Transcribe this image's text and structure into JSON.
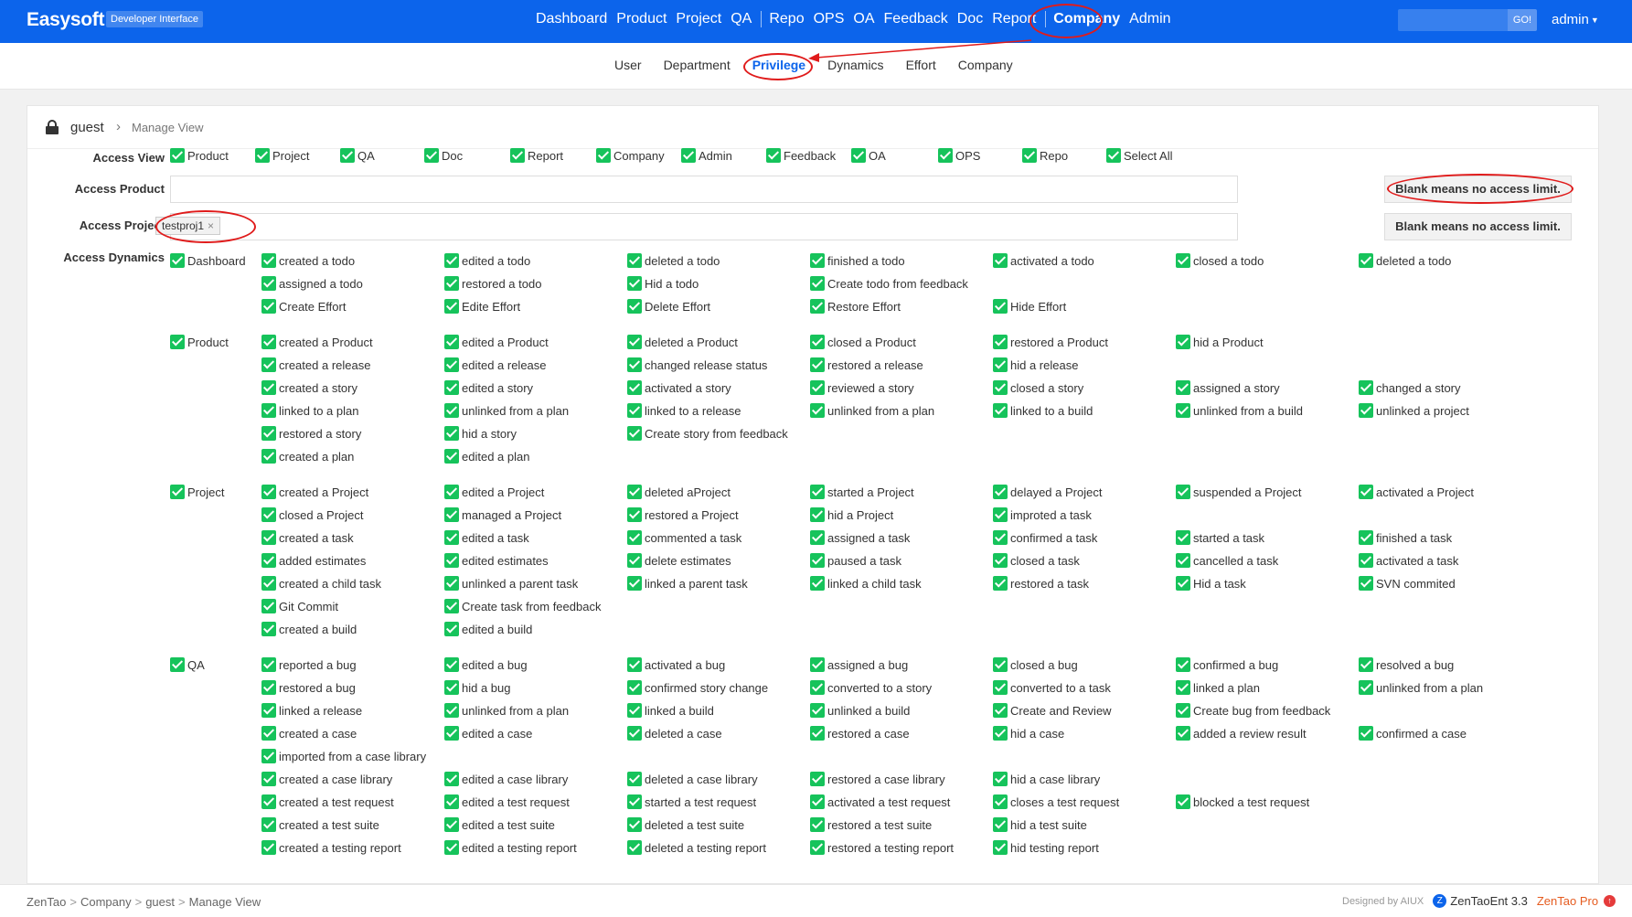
{
  "brand": {
    "name": "Easysoft",
    "badge": "Developer Interface"
  },
  "nav": {
    "items": [
      "Dashboard",
      "Product",
      "Project",
      "QA",
      "Repo",
      "OPS",
      "OA",
      "Feedback",
      "Doc",
      "Report",
      "Company",
      "Admin"
    ],
    "active": "Company"
  },
  "search": {
    "placeholder": "",
    "go_label": "GO!"
  },
  "user": {
    "name": "admin"
  },
  "subnav": {
    "items": [
      "User",
      "Department",
      "Privilege",
      "Dynamics",
      "Effort",
      "Company"
    ],
    "active": "Privilege"
  },
  "breadcrumb": {
    "user": "guest",
    "view": "Manage View"
  },
  "access_view": {
    "label": "Access View",
    "items": [
      "Product",
      "Project",
      "QA",
      "Doc",
      "Report",
      "Company",
      "Admin",
      "Feedback",
      "OA",
      "OPS",
      "Repo",
      "Select All"
    ]
  },
  "access_product": {
    "label": "Access Product",
    "value": "",
    "hint": "Blank means no access limit."
  },
  "access_project": {
    "label": "Access Project",
    "tag": "testproj1",
    "tag_remove": "×",
    "hint": "Blank means no access limit."
  },
  "access_dynamics": {
    "label": "Access Dynamics",
    "groups": [
      {
        "name": "Dashboard",
        "rows": [
          [
            "created a todo",
            "edited a todo",
            "deleted a todo",
            "finished a todo",
            "activated a todo",
            "closed a todo",
            "deleted a todo"
          ],
          [
            "assigned a todo",
            "restored a todo",
            "Hid a todo",
            "Create todo from feedback",
            "",
            "",
            ""
          ],
          [
            "Create Effort",
            "Edite Effort",
            "Delete Effort",
            "Restore Effort",
            "Hide Effort",
            "",
            ""
          ]
        ]
      },
      {
        "name": "Product",
        "rows": [
          [
            "created a Product",
            "edited a Product",
            "deleted a Product",
            "closed a Product",
            "restored a Product",
            "hid a Product",
            ""
          ],
          [
            "created a release",
            "edited a release",
            "changed release status",
            "restored a release",
            "hid a release",
            "",
            ""
          ],
          [
            "created a story",
            "edited a story",
            "activated a story",
            "reviewed a story",
            "closed a story",
            "assigned a story",
            "changed a story"
          ],
          [
            "linked to a plan",
            "unlinked from a plan",
            "linked to a release",
            "unlinked from a plan",
            "linked to a build",
            "unlinked from a build",
            "unlinked a project"
          ],
          [
            "restored a story",
            "hid a story",
            "Create story from feedback",
            "",
            "",
            "",
            ""
          ],
          [
            "created a plan",
            "edited a plan",
            "",
            "",
            "",
            "",
            ""
          ]
        ]
      },
      {
        "name": "Project",
        "rows": [
          [
            "created a Project",
            "edited a Project",
            "deleted aProject",
            "started a Project",
            "delayed a Project",
            "suspended a Project",
            "activated a Project"
          ],
          [
            "closed a Project",
            "managed a Project",
            "restored a Project",
            "hid a Project",
            "improted a task",
            "",
            ""
          ],
          [
            "created a task",
            "edited a task",
            "commented a task",
            "assigned a task",
            "confirmed a task",
            "started a task",
            "finished a task"
          ],
          [
            "added estimates",
            "edited estimates",
            "delete estimates",
            "paused a task",
            "closed a task",
            "cancelled a task",
            "activated a task"
          ],
          [
            "created a child task",
            "unlinked a parent task",
            "linked a parent task",
            "linked a child task",
            "restored a task",
            "Hid a task",
            "SVN commited"
          ],
          [
            "Git Commit",
            "Create task from feedback",
            "",
            "",
            "",
            "",
            ""
          ],
          [
            "created a build",
            "edited a build",
            "",
            "",
            "",
            "",
            ""
          ]
        ]
      },
      {
        "name": "QA",
        "rows": [
          [
            "reported a bug",
            "edited a bug",
            "activated a bug",
            "assigned a bug",
            "closed a bug",
            "confirmed a bug",
            "resolved a bug"
          ],
          [
            "restored a bug",
            "hid a bug",
            "confirmed story change",
            "converted to a story",
            "converted to a task",
            "linked a plan",
            "unlinked from a plan"
          ],
          [
            "linked a release",
            "unlinked from a plan",
            "linked a build",
            "unlinked a build",
            "Create and Review",
            "Create bug from feedback",
            ""
          ],
          [
            "created a case",
            "edited a case",
            "deleted a case",
            "restored a case",
            "hid a case",
            "added a review result",
            "confirmed a case"
          ],
          [
            "imported from a case library",
            "",
            "",
            "",
            "",
            "",
            ""
          ],
          [
            "created a case library",
            "edited a case library",
            "deleted a case library",
            "restored a case library",
            "hid a case library",
            "",
            ""
          ],
          [
            "created a test request",
            "edited a test request",
            "started a test request",
            "activated a test request",
            "closes a test request",
            "blocked a test request",
            ""
          ],
          [
            "created a test suite",
            "edited a test suite",
            "deleted a test suite",
            "restored a test suite",
            "hid a test suite",
            "",
            ""
          ],
          [
            "created a testing report",
            "edited a testing report",
            "deleted a testing report",
            "restored a testing report",
            "hid testing report",
            "",
            ""
          ]
        ]
      }
    ]
  },
  "footer": {
    "breadcrumbs": [
      "ZenTao",
      "Company",
      "guest",
      "Manage View"
    ],
    "designed_by": "Designed by AIUX",
    "edition": "ZenTaoEnt 3.3",
    "pro": "ZenTao Pro"
  },
  "colors": {
    "primary": "#0c64eb",
    "checkbox": "#16c35b",
    "annotation": "#e01b1b"
  }
}
